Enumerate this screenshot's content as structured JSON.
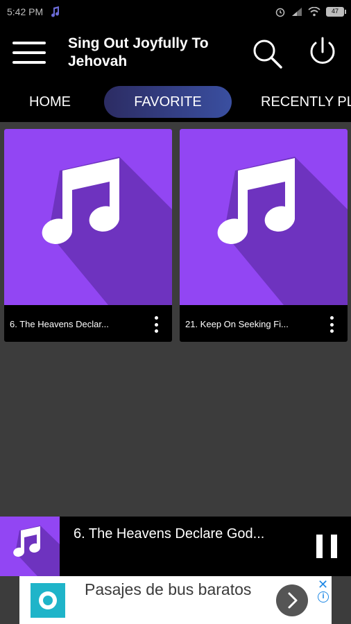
{
  "status_bar": {
    "time": "5:42 PM",
    "battery": "47"
  },
  "app_bar": {
    "title": "Sing Out Joyfully To Jehovah"
  },
  "tabs": [
    {
      "label": "HOME",
      "selected": false
    },
    {
      "label": "FAVORITE",
      "selected": true
    },
    {
      "label": "RECENTLY PL",
      "selected": false
    }
  ],
  "songs": [
    {
      "title": "6. The Heavens Declar..."
    },
    {
      "title": "21. Keep On Seeking Fi..."
    }
  ],
  "now_playing": {
    "title": "6. The Heavens Declare God..."
  },
  "ad": {
    "text": "Pasajes de bus baratos",
    "close_glyph": "✕",
    "info_glyph": "i"
  },
  "colors": {
    "accent_purple": "#9246f3",
    "tab_selected": "#3a4fa0",
    "background": "#3c3c3c",
    "bar": "#000000"
  }
}
